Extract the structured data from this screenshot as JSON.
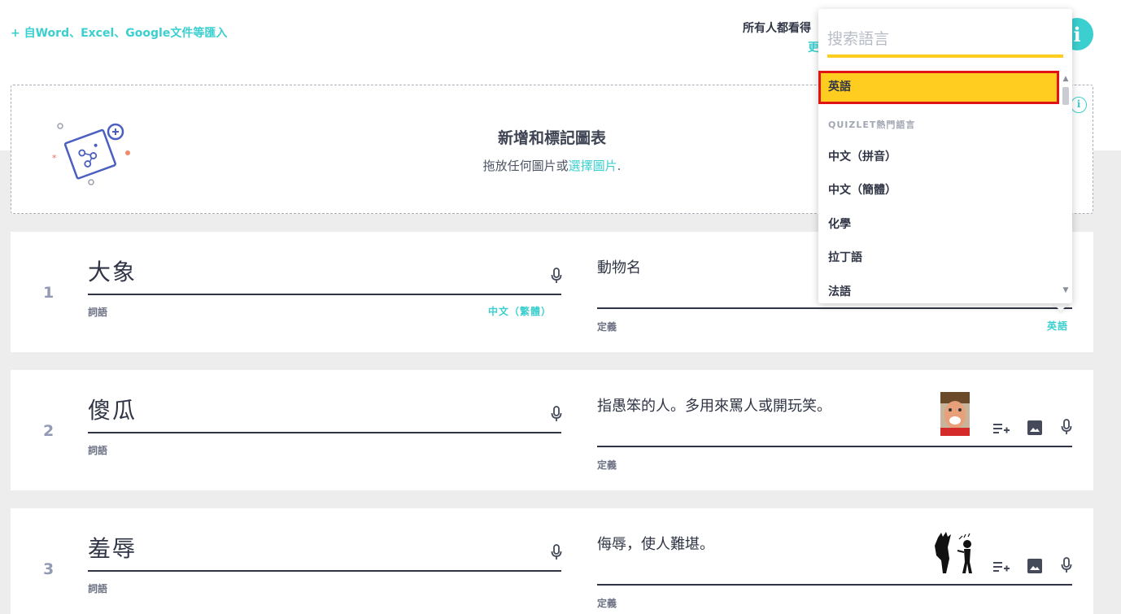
{
  "header": {
    "import_link": "+ 自Word、Excel、Google文件等匯入",
    "visibility_label": "所有人都看得",
    "visibility_change": "更"
  },
  "diagram": {
    "title": "新增和標記圖表",
    "subtitle_prefix": "拖放任何圖片或",
    "subtitle_link": "選擇圖片",
    "subtitle_suffix": "."
  },
  "cards": [
    {
      "number": "1",
      "term": "大象",
      "term_label": "詞語",
      "term_language": "中文（繁體）",
      "definition": "動物名",
      "definition_label": "定義",
      "definition_language": "英語"
    },
    {
      "number": "2",
      "term": "傻瓜",
      "term_label": "詞語",
      "definition": "指愚笨的人。多用來罵人或開玩笑。",
      "definition_label": "定義"
    },
    {
      "number": "3",
      "term": "羞辱",
      "term_label": "詞語",
      "definition": "侮辱，使人難堪。",
      "definition_label": "定義"
    }
  ],
  "language_dropdown": {
    "search_placeholder": "搜索語言",
    "selected": "英語",
    "section_title": "QUIZLET熱門語言",
    "items": [
      "中文（拼音）",
      "中文（簡體）",
      "化學",
      "拉丁語",
      "法語"
    ]
  },
  "colors": {
    "accent_teal": "#3ccfcf",
    "highlight_yellow": "#ffcd1f",
    "selection_border_red": "#e01414",
    "text_dark": "#303545"
  }
}
